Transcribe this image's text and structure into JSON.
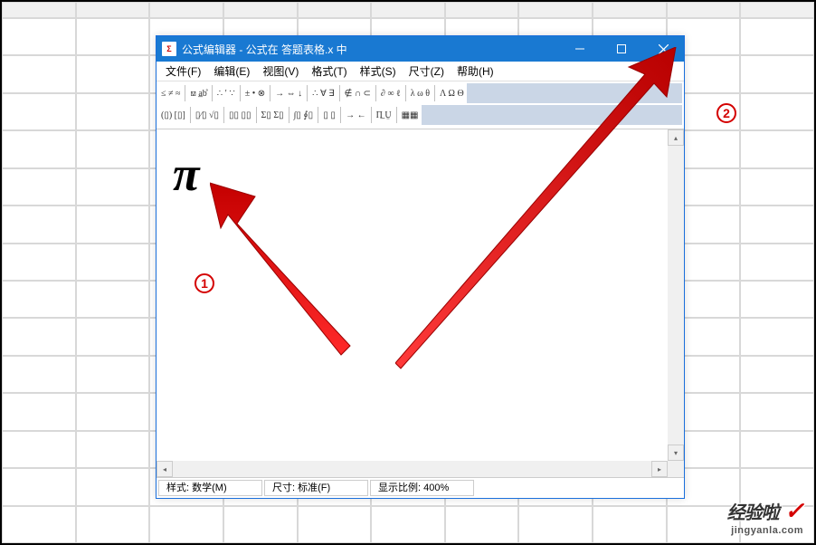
{
  "window": {
    "title": "公式编辑器 - 公式在 答题表格.x 中"
  },
  "menus": {
    "file": "文件(F)",
    "edit": "编辑(E)",
    "view": "视图(V)",
    "format": "格式(T)",
    "style": "样式(S)",
    "size": "尺寸(Z)",
    "help": "帮助(H)"
  },
  "toolbar": {
    "row1": {
      "g1": "≤ ≠ ≈",
      "g2": "⟏ a̲b̊",
      "g3": "∴ ′ ∵",
      "g4": "± • ⊗",
      "g5": "→ ⇔ ↓",
      "g6": "∴ ∀ ∃",
      "g7": "∉ ∩ ⊂",
      "g8": "∂ ∞ ℓ",
      "g9": "λ ω θ",
      "g10": "Λ Ω Θ"
    },
    "row2": {
      "g1": "(▯) [▯]",
      "g2": "▯⁄▯ √▯",
      "g3": "▯▯ ▯▯",
      "g4": "Σ▯ Σ▯",
      "g5": "∫▯ ∮▯",
      "g6": "▯ ▯",
      "g7": "→ ←",
      "g8": "Π̲ Ṳ",
      "g9": "▦▦"
    }
  },
  "editor": {
    "symbol": "π"
  },
  "status": {
    "style_label": "样式:",
    "style_value": "数学(M)",
    "size_label": "尺寸:",
    "size_value": "标准(F)",
    "zoom_label": "显示比例:",
    "zoom_value": "400%"
  },
  "markers": {
    "m1": "1",
    "m2": "2"
  },
  "watermark": {
    "top": "经验啦",
    "url": "jingyanla.com"
  }
}
